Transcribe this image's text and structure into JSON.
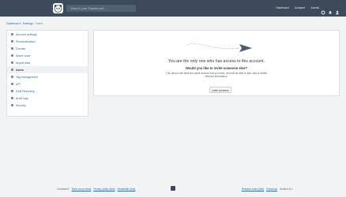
{
  "header": {
    "search_placeholder": "Search your Dashboard...",
    "links": [
      "Dashboard",
      "Compare",
      "Journal"
    ],
    "icons": [
      "gear-icon",
      "bell-icon",
      "user-icon"
    ]
  },
  "breadcrumb": {
    "items": [
      "Dashboard",
      "Settings",
      "Users"
    ]
  },
  "sidebar": {
    "items": [
      {
        "label": "Account settings",
        "icon": "gear-icon"
      },
      {
        "label": "Personalization",
        "icon": "palette-icon"
      },
      {
        "label": "Domain",
        "icon": "globe-icon"
      },
      {
        "label": "Share code",
        "icon": "share-icon"
      },
      {
        "label": "Import data",
        "icon": "import-icon"
      },
      {
        "label": "Users",
        "icon": "users-icon"
      },
      {
        "label": "Tag management",
        "icon": "tag-icon"
      },
      {
        "label": "API",
        "icon": "code-icon"
      },
      {
        "label": "SAB Reporting",
        "icon": "report-icon"
      },
      {
        "label": "Audit logs",
        "icon": "log-icon"
      },
      {
        "label": "Security",
        "icon": "shield-icon"
      }
    ]
  },
  "main": {
    "title": "You are the only one who has access to this account.",
    "subtitle": "Would you like to invite someone else?",
    "description": "This person will have the same access that you have, and will be able to add, edit or delete relevant information.",
    "button": "Invite someone"
  },
  "footer": {
    "left_prefix": "Comment?",
    "left_links": [
      "Send us an email",
      "Privacy policy (link)",
      "Newsletter (link)"
    ],
    "right_links": [
      "Release notes (link)",
      "Facebook"
    ],
    "version": "Version 8.1"
  },
  "colors": {
    "topbar": "#3c4a5c",
    "accent": "#2e6da4"
  }
}
